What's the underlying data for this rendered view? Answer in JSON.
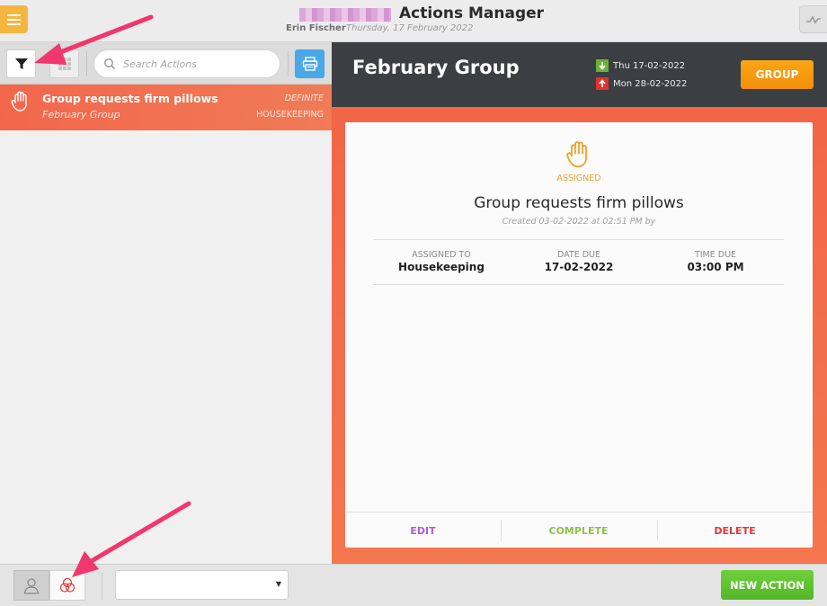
{
  "header": {
    "app_title": "Actions Manager",
    "user_name": "Erin Fischer",
    "date": "Thursday, 17 February 2022"
  },
  "toolbar": {
    "search_placeholder": "Search Actions"
  },
  "action_list": [
    {
      "title": "Group requests firm pillows",
      "group": "February Group",
      "status": "DEFINITE",
      "department": "HOUSEKEEPING",
      "icon": "hand-icon"
    }
  ],
  "detail_header": {
    "group_name": "February Group",
    "arrival": "Thu 17-02-2022",
    "departure": "Mon 28-02-2022",
    "group_button": "GROUP"
  },
  "detail": {
    "status": "ASSIGNED",
    "title": "Group requests firm pillows",
    "created": "Created 03-02-2022 at 02:51 PM by",
    "assigned_to_label": "ASSIGNED TO",
    "assigned_to": "Housekeeping",
    "date_due_label": "DATE DUE",
    "date_due": "17-02-2022",
    "time_due_label": "TIME DUE",
    "time_due": "03:00 PM",
    "actions": {
      "edit": "EDIT",
      "complete": "COMPLETE",
      "delete": "DELETE"
    }
  },
  "bottom": {
    "select_value": "",
    "new_action": "NEW ACTION"
  },
  "colors": {
    "accent_orange": "#f2674c",
    "menu_yellow": "#f5b640",
    "group_button": "#f7990f",
    "new_action_green": "#5fc232",
    "edit": "#b45ad1",
    "complete": "#8bc34a",
    "delete": "#e53935",
    "callout_arrow": "#f2366e"
  }
}
